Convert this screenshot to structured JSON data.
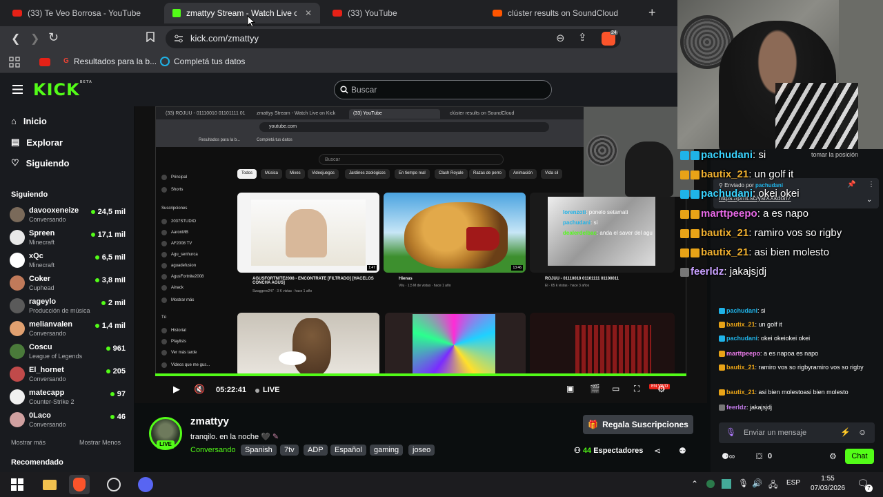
{
  "browser": {
    "tabs": [
      {
        "title": "(33) Te Veo Borrosa - YouTube",
        "favicon": "youtube-icon"
      },
      {
        "title": "zmattyy Stream - Watch Live on K",
        "favicon": "kick-icon",
        "active": true
      },
      {
        "title": "(33) YouTube",
        "favicon": "youtube-icon"
      },
      {
        "title": "clúster results on SoundCloud",
        "favicon": "soundcloud-icon"
      }
    ],
    "url": "kick.com/zmattyy",
    "shield_count": "24",
    "bookmarks": [
      {
        "label": "Resultados para la b..."
      },
      {
        "label": "Completá tus datos"
      }
    ]
  },
  "kick": {
    "logo": "KICK",
    "logo_sup": "BETA",
    "search_placeholder": "Buscar",
    "nav": [
      {
        "label": "Inicio",
        "icon": "home-icon"
      },
      {
        "label": "Explorar",
        "icon": "compass-icon"
      },
      {
        "label": "Siguiendo",
        "icon": "heart-icon"
      }
    ],
    "following_title": "Siguiendo",
    "channels": [
      {
        "name": "davooxeneize",
        "category": "Conversando",
        "viewers": "24,5 mil",
        "color": "#7a6a5a"
      },
      {
        "name": "Spreen",
        "category": "Minecraft",
        "viewers": "17,1 mil",
        "color": "#e8e8e8"
      },
      {
        "name": "xQc",
        "category": "Minecraft",
        "viewers": "6,5 mil",
        "color": "#ffffff"
      },
      {
        "name": "Coker",
        "category": "Cuphead",
        "viewers": "3,8 mil",
        "color": "#c07a5a"
      },
      {
        "name": "rageylo",
        "category": "Producción de música",
        "viewers": "2 mil",
        "color": "#5a5a5a"
      },
      {
        "name": "melianvalen",
        "category": "Conversando",
        "viewers": "1,4 mil",
        "color": "#e0a070"
      },
      {
        "name": "Coscu",
        "category": "League of Legends",
        "viewers": "961",
        "color": "#4a7a3a"
      },
      {
        "name": "El_hornet",
        "category": "Conversando",
        "viewers": "205",
        "color": "#c04a4a"
      },
      {
        "name": "matecapp",
        "category": "Counter-Strike 2",
        "viewers": "97",
        "color": "#f0f0f0"
      },
      {
        "name": "0Laco",
        "category": "Conversando",
        "viewers": "46",
        "color": "#d0a0a0"
      }
    ],
    "show_more": "Mostrar más",
    "show_less": "Mostrar Menos",
    "recommended_title": "Recomendado"
  },
  "inner": {
    "tabs": [
      "(33) ROJUU - 01110010 01101111 01",
      "zmattyy Stream - Watch Live on Kick",
      "(33) YouTube",
      "clúster results on SoundCloud"
    ],
    "url": "youtube.com",
    "bookmarks": [
      "Resultados para la b...",
      "Completá tus datos"
    ],
    "search_placeholder": "Buscar",
    "side": [
      "Principal",
      "Shorts",
      "Suscripciones",
      "2037STUDIO",
      "AaronMB",
      "AF2008 TV",
      "Agu_senhurca",
      "aguadefusion",
      "AgusFortnite2008",
      "Ainack",
      "Mostrar más",
      "Tú",
      "Historial",
      "Playlists",
      "Ver más tarde",
      "Videos que me gus..."
    ],
    "chips": [
      "Todos",
      "Música",
      "Mixes",
      "Videojuegos",
      "Jardines zoológicos",
      "En tiempo real",
      "Clash Royale",
      "Razas de perro",
      "Animación",
      "Vida sil"
    ],
    "videos": [
      {
        "title": "AGUSFORTNITE2008 - ENCONTRATE [FILTRADO] [HACELOS CONCHA AGUS]",
        "meta": "Swaggero247 · 3 K vistas · hace 1 año",
        "duration": "1:47"
      },
      {
        "title": "Hienas",
        "meta": "Vilu · 1,5 M de vistas · hace 1 año",
        "duration": "13:46"
      },
      {
        "title": "ROJUU - 01110010 01101111 01100011",
        "meta": "El · 65 k vistas · hace 3 años",
        "duration": ""
      }
    ],
    "overlay_chat": [
      {
        "user": "lorenzoti",
        "msg": "ponelo setamati"
      },
      {
        "user": "pachudani",
        "msg": "si"
      },
      {
        "user": "dealerdelbac",
        "msg": "anda el saver del agu"
      }
    ]
  },
  "player": {
    "time": "05:22:41",
    "live": "LIVE",
    "live_pill": "EN VIVO"
  },
  "stream": {
    "name": "zmattyy",
    "title": "tranqilo. en la noche",
    "category": "Conversando",
    "tags": [
      "Spanish",
      "7tv",
      "ADP",
      "Español",
      "gaming",
      "joseo"
    ],
    "live_badge": "LIVE",
    "gift_label": "Regala Suscripciones",
    "viewers": "44",
    "viewers_label": "Espectadores"
  },
  "overlay": [
    {
      "user": "pachudani",
      "msg": "si",
      "badge": "b"
    },
    {
      "user": "bautix_21",
      "msg": "un golf it",
      "badge": "y"
    },
    {
      "user": "pachudani",
      "msg": "okei okei",
      "badge": "b"
    },
    {
      "user": "marttpeepo",
      "msg": "a es napo",
      "badge": "y"
    },
    {
      "user": "bautix_21",
      "msg": "ramiro vos so rigby",
      "badge": "y"
    },
    {
      "user": "bautix_21",
      "msg": "asi bien molesto",
      "badge": "y"
    },
    {
      "user": "feerldz",
      "msg": "jakajsjdj",
      "badge": "g"
    }
  ],
  "chat": {
    "pinned_by": "Enviado por",
    "pinned_user": "pachudani",
    "pinned_link": "https://prnt.sc/ysfXXkdorl7",
    "pinned_hint": "tomar la posición",
    "messages": [
      {
        "user": "pachudani",
        "msg": "si",
        "badge": "b"
      },
      {
        "user": "bautix_21",
        "msg": "un golf it",
        "badge": "y"
      },
      {
        "user": "pachudani",
        "msg": "okei okeiokei okei",
        "badge": "b"
      },
      {
        "user": "marttpeepo",
        "msg": "a es napoa es napo",
        "badge": "y"
      },
      {
        "user": "bautix_21",
        "msg": "ramiro vos so rigbyramiro vos so rigby",
        "badge": "y"
      },
      {
        "user": "bautix_21",
        "msg": "asi bien molestoasi bien molesto",
        "badge": "y"
      },
      {
        "user": "feerldz",
        "msg": "jakajsjdj",
        "badge": "g"
      }
    ],
    "placeholder": "Enviar un mensaje",
    "points": "0",
    "send_label": "Chat"
  },
  "taskbar": {
    "lang": "ESP",
    "time": "1:55",
    "date": "07/03/2026",
    "notif_count": "7"
  }
}
